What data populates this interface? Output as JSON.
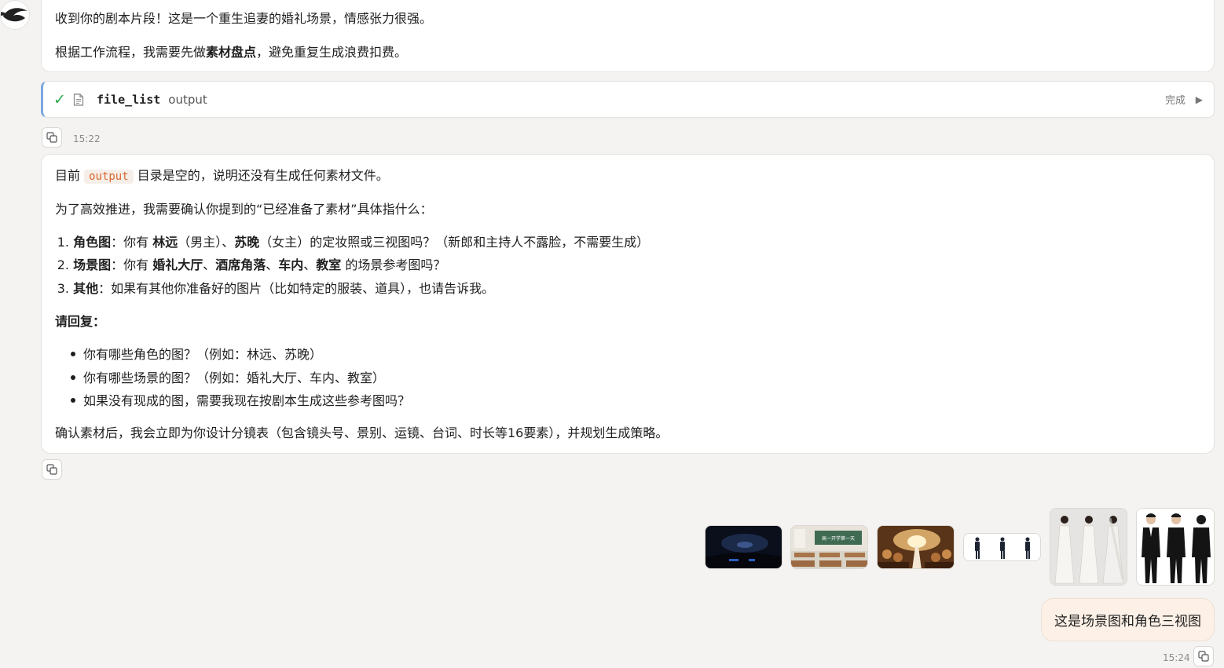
{
  "messages": {
    "first": {
      "line1": "收到你的剧本片段！这是一个重生追妻的婚礼场景，情感张力很强。",
      "line2_before": "根据工作流程，我需要先做",
      "line2_bold": "素材盘点",
      "line2_after": "，避免重复生成浪费扣费。"
    },
    "tool_call": {
      "name": "file_list",
      "arg": "output",
      "status": "完成"
    },
    "time1": "15:22",
    "second": {
      "line1_before": "目前 ",
      "line1_code": "output",
      "line1_after": " 目录是空的，说明还没有生成任何素材文件。",
      "line2": "为了高效推进，我需要确认你提到的“已经准备了素材”具体指什么：",
      "ol": [
        {
          "num": "1.",
          "label": "角色图",
          "t1": "：你有 ",
          "b1": "林远",
          "t2": "（男主）、",
          "b2": "苏晚",
          "t3": "（女主）的定妆照或三视图吗？（新郎和主持人不露脸，不需要生成）"
        },
        {
          "num": "2.",
          "label": "场景图",
          "t1": "：你有 ",
          "b1": "婚礼大厅",
          "t2": "、",
          "b2": "酒席角落",
          "t3": "、",
          "b3": "车内",
          "t4": "、",
          "b4": "教室",
          "t5": " 的场景参考图吗？"
        },
        {
          "num": "3.",
          "label": "其他",
          "t1": "：如果有其他你准备好的图片（比如特定的服装、道具），也请告诉我。"
        }
      ],
      "reply_heading": "请回复：",
      "ul": [
        "你有哪些角色的图？（例如：林远、苏晚）",
        "你有哪些场景的图？（例如：婚礼大厅、车内、教室）",
        "如果没有现成的图，需要我现在按剧本生成这些参考图吗？"
      ],
      "closing": "确认素材后，我会立即为你设计分镜表（包含镜头号、景别、运镜、台词、时长等16要素），并规划生成策略。"
    },
    "attachments": [
      {
        "name": "car-interior-night",
        "icon": "image"
      },
      {
        "name": "classroom",
        "icon": "image"
      },
      {
        "name": "wedding-hall",
        "icon": "image"
      },
      {
        "name": "groom-turnaround-small",
        "icon": "image"
      },
      {
        "name": "bride-turnaround",
        "icon": "image"
      },
      {
        "name": "groom-turnaround",
        "icon": "image"
      }
    ],
    "classroom_board_text": "高一开学第一天",
    "user": {
      "text": "这是场景图和角色三视图",
      "time": "15:24"
    }
  },
  "colors": {
    "accent_border": "#7aa7df",
    "check": "#2aa84a",
    "code_text": "#d9692f",
    "user_bubble": "#fdf1e7"
  }
}
